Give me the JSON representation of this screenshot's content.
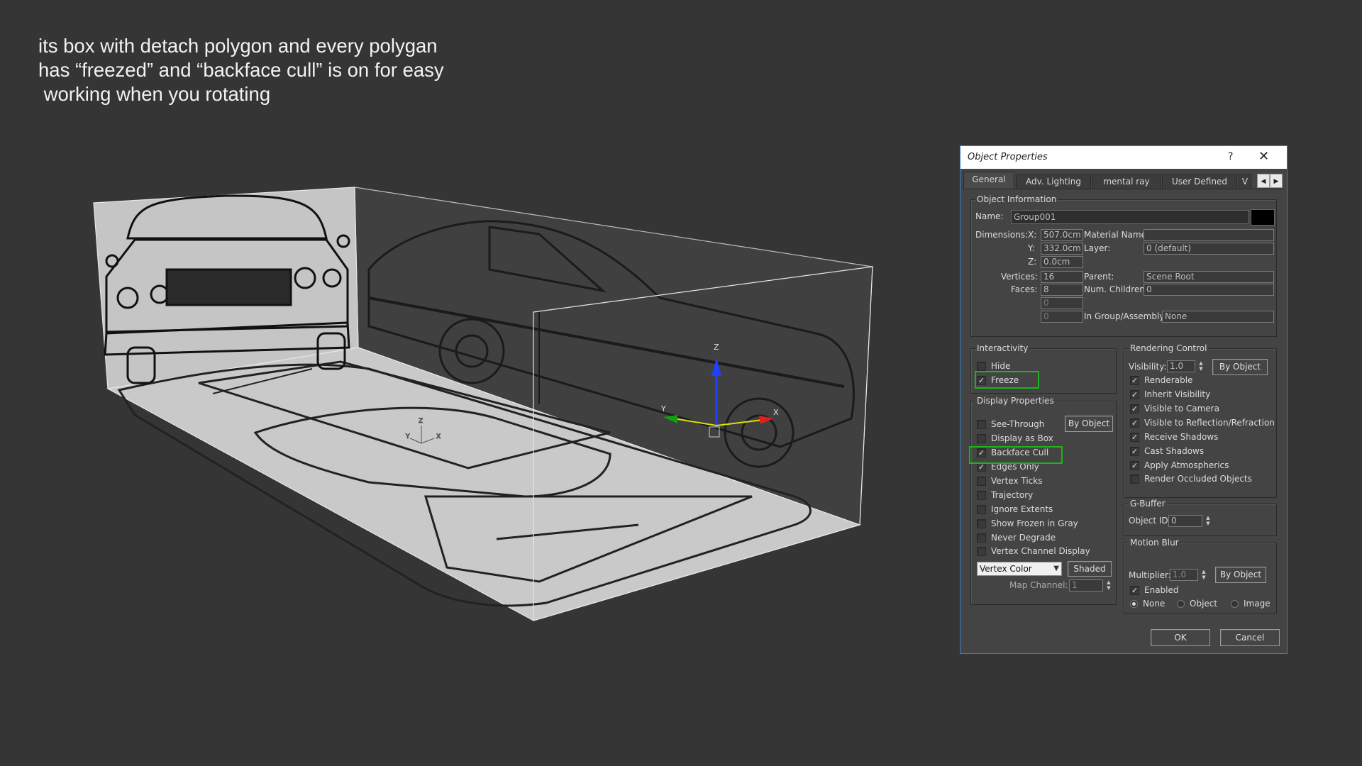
{
  "caption": {
    "line1": "its box with detach polygon and every polygan",
    "line2": "has “freezed” and “backface cull” is on for easy",
    "line3": " working when you rotating"
  },
  "viewport": {
    "gizmo_axes": [
      "Z",
      "Y",
      "X"
    ],
    "small_axes": [
      "Z",
      "Y",
      "X"
    ]
  },
  "dialog": {
    "title": "Object Properties",
    "help": "?",
    "close": "✕",
    "tabs": [
      "General",
      "Adv. Lighting",
      "mental ray",
      "User Defined",
      "V"
    ],
    "object_info": {
      "title": "Object Information",
      "name_label": "Name:",
      "name_value": "Group001",
      "dimensions_label": "Dimensions:",
      "x_label": "X:",
      "x_value": "507.0cm",
      "y_label": "Y:",
      "y_value": "332.0cm",
      "z_label": "Z:",
      "z_value": "0.0cm",
      "vertices_label": "Vertices:",
      "vertices_value": "16",
      "faces_label": "Faces:",
      "faces_value": "8",
      "extra1": "0",
      "extra2": "0",
      "material_label": "Material Name:",
      "material_value": "",
      "layer_label": "Layer:",
      "layer_value": "0 (default)",
      "parent_label": "Parent:",
      "parent_value": "Scene Root",
      "children_label": "Num. Children:",
      "children_value": "0",
      "group_label": "In Group/Assembly:",
      "group_value": "None"
    },
    "interactivity": {
      "title": "Interactivity",
      "hide": "Hide",
      "freeze": "Freeze"
    },
    "display": {
      "title": "Display Properties",
      "by_object": "By Object",
      "items": [
        "See-Through",
        "Display as Box",
        "Backface Cull",
        "Edges Only",
        "Vertex Ticks",
        "Trajectory",
        "Ignore Extents",
        "Show Frozen in Gray",
        "Never Degrade",
        "Vertex Channel Display"
      ],
      "vertex_select": "Vertex Color",
      "shaded": "Shaded",
      "map_channel_label": "Map Channel:",
      "map_channel_value": "1"
    },
    "rendering": {
      "title": "Rendering Control",
      "visibility_label": "Visibility:",
      "visibility_value": "1.0",
      "by_object": "By Object",
      "items": [
        "Renderable",
        "Inherit Visibility",
        "Visible to Camera",
        "Visible to Reflection/Refraction",
        "Receive Shadows",
        "Cast Shadows",
        "Apply Atmospherics",
        "Render Occluded Objects"
      ]
    },
    "gbuffer": {
      "title": "G-Buffer",
      "object_id_label": "Object ID:",
      "object_id_value": "0"
    },
    "motion_blur": {
      "title": "Motion Blur",
      "multiplier_label": "Multiplier:",
      "multiplier_value": "1.0",
      "by_object": "By Object",
      "enabled": "Enabled",
      "none": "None",
      "object": "Object",
      "image": "Image"
    },
    "ok": "OK",
    "cancel": "Cancel"
  }
}
